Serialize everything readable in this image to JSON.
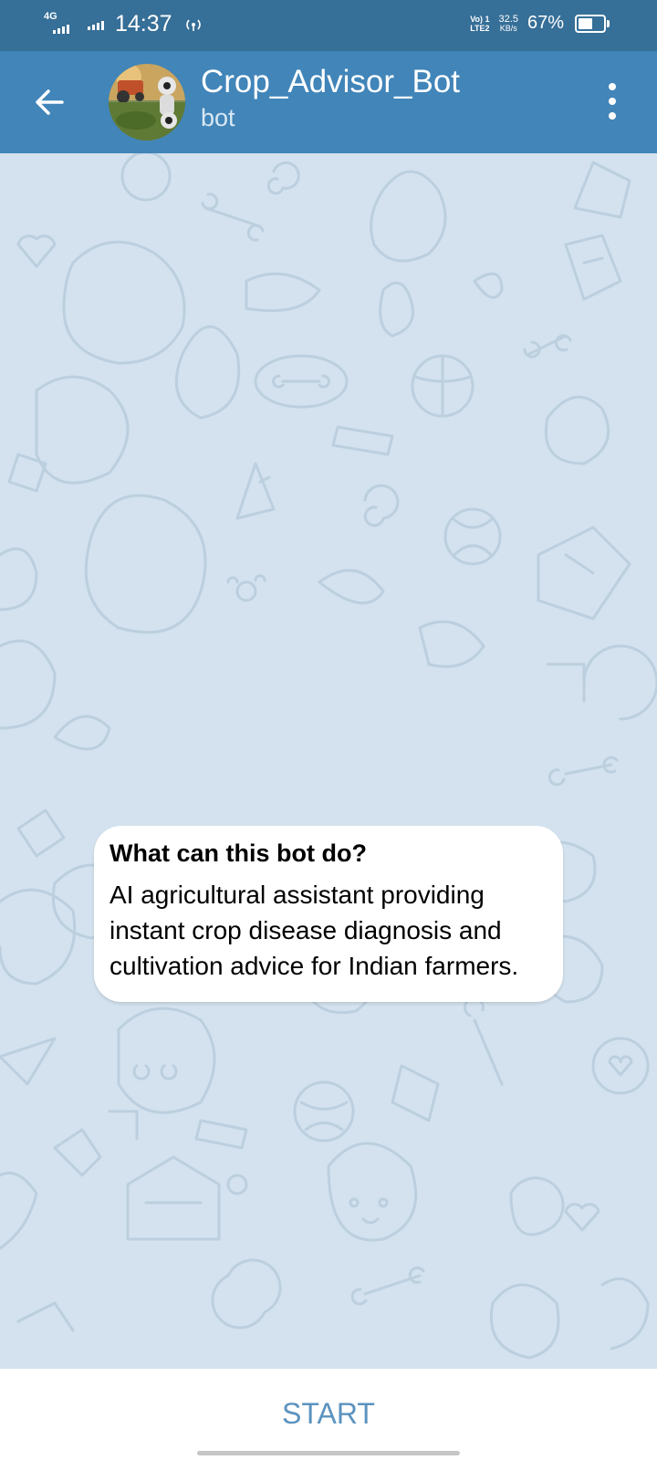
{
  "status_bar": {
    "network": "4G",
    "time": "14:37",
    "volte_top": "Vo) 1",
    "volte_bottom": "LTE2",
    "speed_value": "32.5",
    "speed_unit": "KB/s",
    "battery_percent": "67%",
    "battery_level": 0.67
  },
  "header": {
    "title": "Crop_Advisor_Bot",
    "subtitle": "bot",
    "back_icon": "arrow-left-icon",
    "menu_icon": "more-vertical-icon"
  },
  "bot_info": {
    "heading": "What can this bot do?",
    "description": "AI agricultural assistant providing instant crop disease diagnosis and cultivation advice for Indian farmers."
  },
  "footer": {
    "start_label": "START"
  },
  "colors": {
    "status_bar": "#366f97",
    "header": "#4185b9",
    "chat_background": "#d3e2ee",
    "start_text": "#5b93bf"
  }
}
